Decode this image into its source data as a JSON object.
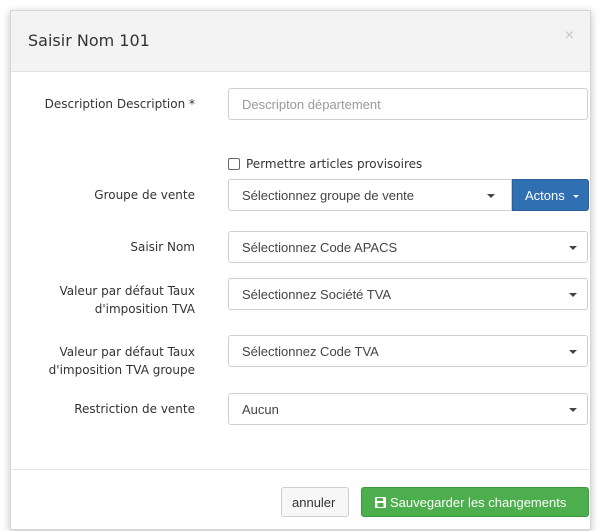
{
  "modal": {
    "title": "Saisir Nom 101",
    "close_glyph": "×"
  },
  "form": {
    "description": {
      "label": "Description Description *",
      "placeholder": "Descripton département",
      "value": ""
    },
    "allow_temp_articles": {
      "label": "Permettre articles provisoires",
      "checked": false
    },
    "sales_group": {
      "label": "Groupe de vente",
      "selected": "Sélectionnez groupe de vente",
      "actions_label": "Actons"
    },
    "enter_name": {
      "label": "Saisir Nom",
      "selected": "Sélectionnez Code APACS"
    },
    "default_vat_rate": {
      "label_line1": "Valeur par défaut Taux",
      "label_line2": "d'imposition TVA",
      "selected": "Sélectionnez Société TVA"
    },
    "default_vat_group": {
      "label_line1": "Valeur par défaut Taux",
      "label_line2": "d'imposition TVA groupe",
      "selected": "Sélectionnez Code TVA"
    },
    "sales_restriction": {
      "label": "Restriction de vente",
      "selected": "Aucun"
    }
  },
  "footer": {
    "cancel_label": "annuler",
    "save_label": "Sauvegarder les changements"
  },
  "colors": {
    "primary": "#2f6fb2",
    "success": "#4cae4c",
    "header_bg": "#f3f3f3"
  },
  "icons": {
    "save": "floppy-disk-icon",
    "close": "close-icon",
    "dropdown": "caret-down-icon"
  }
}
